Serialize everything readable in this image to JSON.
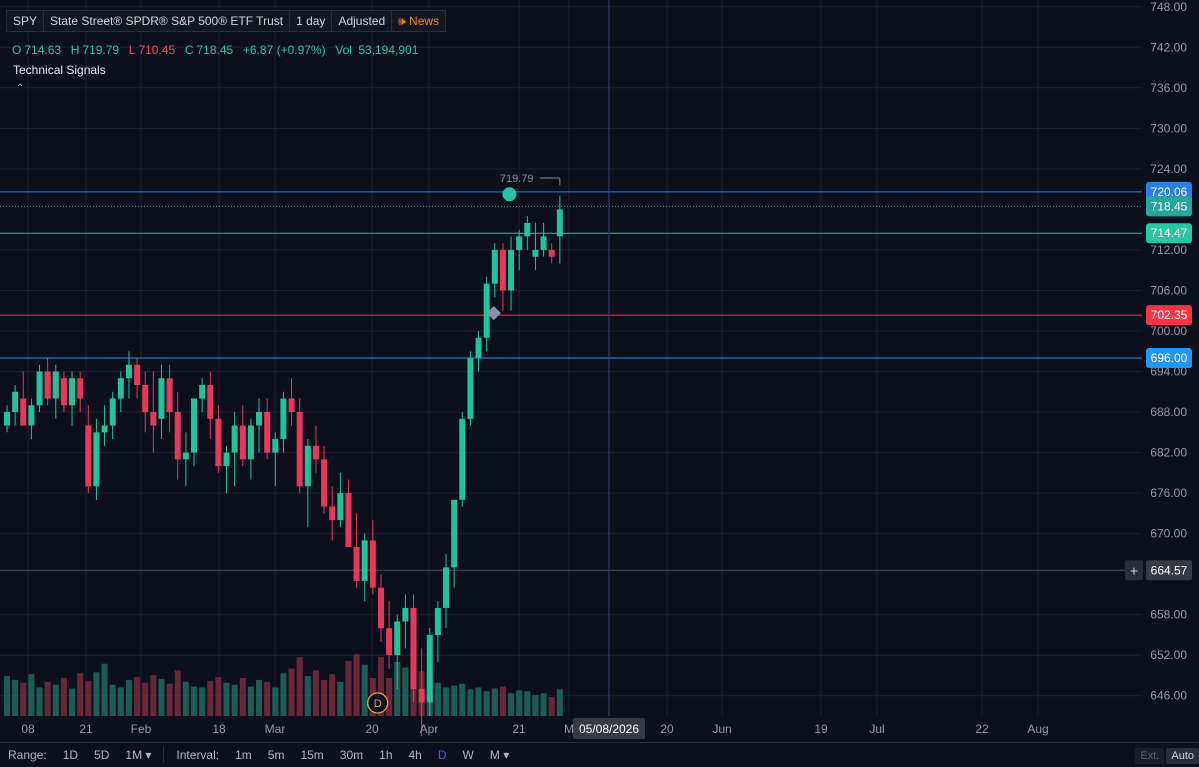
{
  "header": {
    "symbol": "SPY",
    "name": "State Street® SPDR® S&P 500® ETF Trust",
    "interval": "1 day",
    "adjustment": "Adjusted",
    "news_label": "News"
  },
  "ohlc": {
    "o_label": "O",
    "o": "714.63",
    "h_label": "H",
    "h": "719.79",
    "l_label": "L",
    "l": "710.45",
    "c_label": "C",
    "c": "718.45",
    "change": "+6.87 (+0.97%)",
    "vol_label": "Vol",
    "vol": "53,194,901"
  },
  "indicator_panel": {
    "title": "Technical Signals",
    "collapse_icon": "chevron-up-icon"
  },
  "chart_data": {
    "type": "candlestick",
    "y_axis": {
      "min": 643,
      "max": 749,
      "ticks": [
        "748.00",
        "742.00",
        "736.00",
        "730.00",
        "724.00",
        "712.00",
        "706.00",
        "700.00",
        "694.00",
        "688.00",
        "682.00",
        "676.00",
        "670.00",
        "658.00",
        "652.00",
        "646.00"
      ]
    },
    "x_axis": {
      "ticks": [
        "08",
        "21",
        "Feb",
        "18",
        "Mar",
        "20",
        "Apr",
        "21",
        "M",
        "20",
        "Jun",
        "19",
        "Jul",
        "22",
        "Aug"
      ]
    },
    "crosshair": {
      "date_label": "05/08/2026",
      "price_label": "664.57",
      "price": 664.57
    },
    "high_annotation": "719.79",
    "lines": [
      {
        "price": 720.6,
        "label": "720.06",
        "color": "#2a7fe0"
      },
      {
        "price": 718.45,
        "label": "718.45",
        "color": "#26a69a",
        "dotted": true
      },
      {
        "price": 714.47,
        "label": "714.47",
        "color": "#26c6a0"
      },
      {
        "price": 702.35,
        "label": "702.35",
        "color": "#f23645"
      },
      {
        "price": 696.0,
        "label": "696.00",
        "color": "#2196f3"
      }
    ],
    "signals": [
      {
        "type": "dot",
        "index": 65,
        "price": 719.2,
        "color": "#26c6a0"
      },
      {
        "type": "diamond",
        "index": 60,
        "price": 702.5,
        "color": "#8a8fa8"
      }
    ],
    "event_marker": {
      "label": "D",
      "index": 44
    },
    "candles": [
      [
        686,
        689,
        685,
        688
      ],
      [
        688,
        692,
        686,
        691
      ],
      [
        690,
        694,
        687,
        686
      ],
      [
        686,
        690,
        684,
        689
      ],
      [
        689,
        695,
        688,
        694
      ],
      [
        694,
        696,
        689,
        690
      ],
      [
        690,
        695,
        687,
        694
      ],
      [
        693,
        694,
        688,
        689
      ],
      [
        689,
        694,
        686,
        693
      ],
      [
        693,
        694,
        688,
        690
      ],
      [
        686,
        689,
        676,
        677
      ],
      [
        677,
        687,
        675,
        685
      ],
      [
        685,
        689,
        683,
        686
      ],
      [
        686,
        691,
        684,
        690
      ],
      [
        690,
        694,
        688,
        693
      ],
      [
        693,
        697,
        690,
        695
      ],
      [
        695,
        696,
        690,
        692
      ],
      [
        692,
        694,
        685,
        688
      ],
      [
        688,
        694,
        682,
        686
      ],
      [
        687,
        695,
        684,
        693
      ],
      [
        693,
        695,
        685,
        688
      ],
      [
        688,
        691,
        678,
        681
      ],
      [
        681,
        685,
        677,
        682
      ],
      [
        682,
        690,
        680,
        690
      ],
      [
        690,
        693,
        688,
        692
      ],
      [
        692,
        694,
        684,
        687
      ],
      [
        687,
        689,
        679,
        680
      ],
      [
        680,
        683,
        676,
        682
      ],
      [
        682,
        688,
        677,
        686
      ],
      [
        686,
        689,
        680,
        681
      ],
      [
        681,
        687,
        678,
        686
      ],
      [
        686,
        690,
        682,
        688
      ],
      [
        688,
        690,
        681,
        682
      ],
      [
        682,
        685,
        677,
        684
      ],
      [
        684,
        691,
        682,
        690
      ],
      [
        690,
        693,
        686,
        688
      ],
      [
        688,
        690,
        676,
        677
      ],
      [
        677,
        684,
        671,
        683
      ],
      [
        683,
        686,
        679,
        681
      ],
      [
        681,
        683,
        673,
        674
      ],
      [
        674,
        677,
        669,
        672
      ],
      [
        672,
        679,
        671,
        676
      ],
      [
        676,
        678,
        668,
        668
      ],
      [
        668,
        673,
        662,
        663
      ],
      [
        663,
        670,
        660,
        669
      ],
      [
        669,
        672,
        661,
        662
      ],
      [
        662,
        664,
        654,
        656
      ],
      [
        656,
        660,
        650,
        652
      ],
      [
        652,
        658,
        647,
        657
      ],
      [
        657,
        661,
        653,
        659
      ],
      [
        659,
        661,
        645,
        647
      ],
      [
        647,
        653,
        640,
        645
      ],
      [
        645,
        656,
        643,
        655
      ],
      [
        655,
        660,
        651,
        659
      ],
      [
        659,
        667,
        656,
        665
      ],
      [
        665,
        674,
        662,
        675
      ],
      [
        675,
        688,
        674,
        687
      ],
      [
        687,
        697,
        686,
        696
      ],
      [
        696,
        700,
        694,
        699
      ],
      [
        699,
        708,
        697,
        707
      ],
      [
        707,
        713,
        705,
        712
      ],
      [
        712,
        713,
        703,
        706
      ],
      [
        706,
        714,
        703,
        712
      ],
      [
        712,
        715,
        709,
        714
      ],
      [
        714,
        717,
        712,
        716
      ],
      [
        711,
        716,
        709,
        712
      ],
      [
        712,
        716,
        711,
        714
      ],
      [
        712,
        713,
        710,
        711
      ],
      [
        714,
        720,
        710,
        718
      ]
    ],
    "volumes": [
      0.42,
      0.38,
      0.35,
      0.44,
      0.3,
      0.36,
      0.33,
      0.4,
      0.29,
      0.45,
      0.37,
      0.46,
      0.55,
      0.33,
      0.3,
      0.38,
      0.41,
      0.35,
      0.43,
      0.39,
      0.34,
      0.48,
      0.36,
      0.31,
      0.3,
      0.37,
      0.41,
      0.35,
      0.33,
      0.4,
      0.31,
      0.38,
      0.36,
      0.3,
      0.45,
      0.5,
      0.62,
      0.42,
      0.48,
      0.38,
      0.44,
      0.36,
      0.58,
      0.65,
      0.54,
      0.4,
      0.62,
      0.4,
      0.57,
      0.51,
      0.72,
      0.47,
      0.42,
      0.35,
      0.3,
      0.32,
      0.34,
      0.28,
      0.3,
      0.26,
      0.29,
      0.31,
      0.24,
      0.27,
      0.26,
      0.22,
      0.24,
      0.2,
      0.28
    ]
  },
  "range_bar": {
    "range_label": "Range:",
    "ranges": [
      "1D",
      "5D",
      "1M ▾"
    ],
    "interval_label": "Interval:",
    "intervals": [
      "1m",
      "5m",
      "15m",
      "30m",
      "1h",
      "4h",
      "D",
      "W",
      "M ▾"
    ],
    "active_interval": "D",
    "ext_label": "Ext.",
    "auto_label": "Auto"
  }
}
